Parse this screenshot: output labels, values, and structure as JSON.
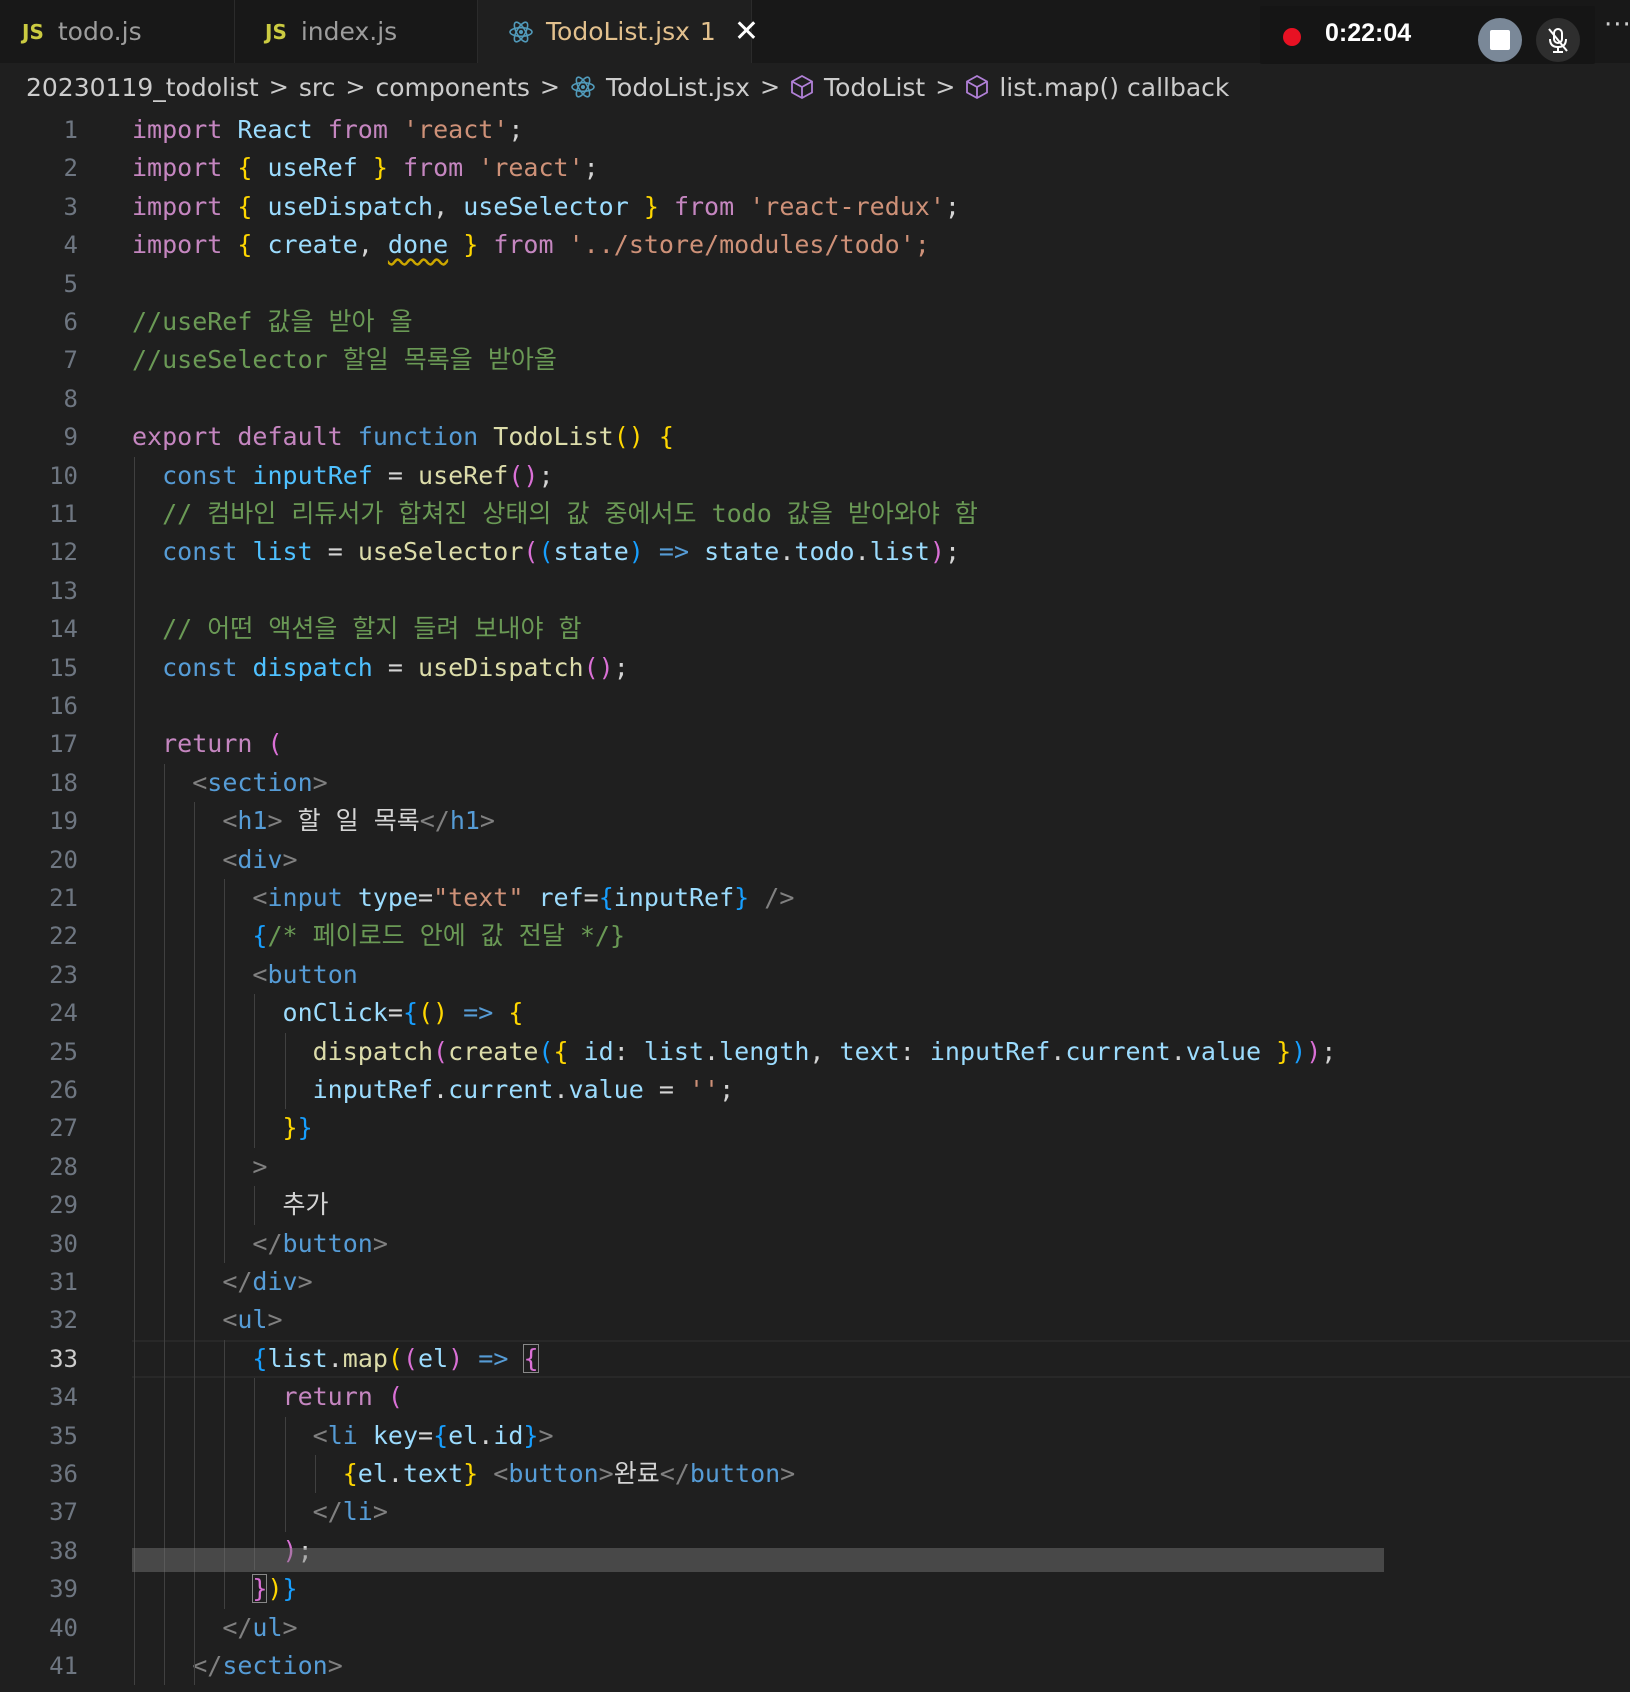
{
  "tabs": [
    {
      "label": "todo.js",
      "icon": "js-file-icon",
      "badge": "JS"
    },
    {
      "label": "index.js",
      "icon": "js-file-icon",
      "badge": "JS"
    },
    {
      "label": "TodoList.jsx",
      "icon": "react-icon",
      "problems": "1",
      "close": "✕"
    }
  ],
  "recorder": {
    "time": "0:22:04",
    "more": "···"
  },
  "breadcrumb": {
    "items": [
      "20230119_todolist",
      "src",
      "components",
      "TodoList.jsx",
      "TodoList",
      "list.map() callback"
    ],
    "separator": ">"
  },
  "editor": {
    "current_line": 33,
    "line_numbers": [
      "1",
      "2",
      "3",
      "4",
      "5",
      "6",
      "7",
      "8",
      "9",
      "10",
      "11",
      "12",
      "13",
      "14",
      "15",
      "16",
      "17",
      "18",
      "19",
      "20",
      "21",
      "22",
      "23",
      "24",
      "25",
      "26",
      "27",
      "28",
      "29",
      "30",
      "31",
      "32",
      "33",
      "34",
      "35",
      "36",
      "37",
      "38",
      "39",
      "40",
      "41"
    ],
    "lines": [
      "import React from 'react';",
      "import { useRef } from 'react';",
      "import { useDispatch, useSelector } from 'react-redux';",
      "import { create, done } from '../store/modules/todo';",
      "",
      "//useRef 값을 받아 올",
      "//useSelector 할일 목록을 받아올",
      "",
      "export default function TodoList() {",
      "  const inputRef = useRef();",
      "  // 컴바인 리듀서가 합쳐진 상태의 값 중에서도 todo 값을 받아와야 함",
      "  const list = useSelector((state) => state.todo.list);",
      "",
      "  // 어떤 액션을 할지 들려 보내야 함",
      "  const dispatch = useDispatch();",
      "",
      "  return (",
      "    <section>",
      "      <h1> 할 일 목록</h1>",
      "      <div>",
      "        <input type=\"text\" ref={inputRef} />",
      "        {/* 페이로드 안에 값 전달 */}",
      "        <button",
      "          onClick={() => {",
      "            dispatch(create({ id: list.length, text: inputRef.current.value }));",
      "            inputRef.current.value = '';",
      "          }}",
      "        >",
      "          추가",
      "        </button>",
      "      </div>",
      "      <ul>",
      "        {list.map((el) => {",
      "          return (",
      "            <li key={el.id}>",
      "              {el.text} <button>완료</button>",
      "            </li>",
      "          );",
      "        })}",
      "      </ul>",
      "    </section>"
    ]
  },
  "colors": {
    "background": "#1f1f1f",
    "tab_active_text": "#e2c08d",
    "keyword": "#c586c0",
    "storage": "#569cd6",
    "function": "#dcdcaa",
    "variable": "#9cdcfe",
    "string": "#ce9178",
    "comment": "#6a9955",
    "recording": "#e81123"
  }
}
